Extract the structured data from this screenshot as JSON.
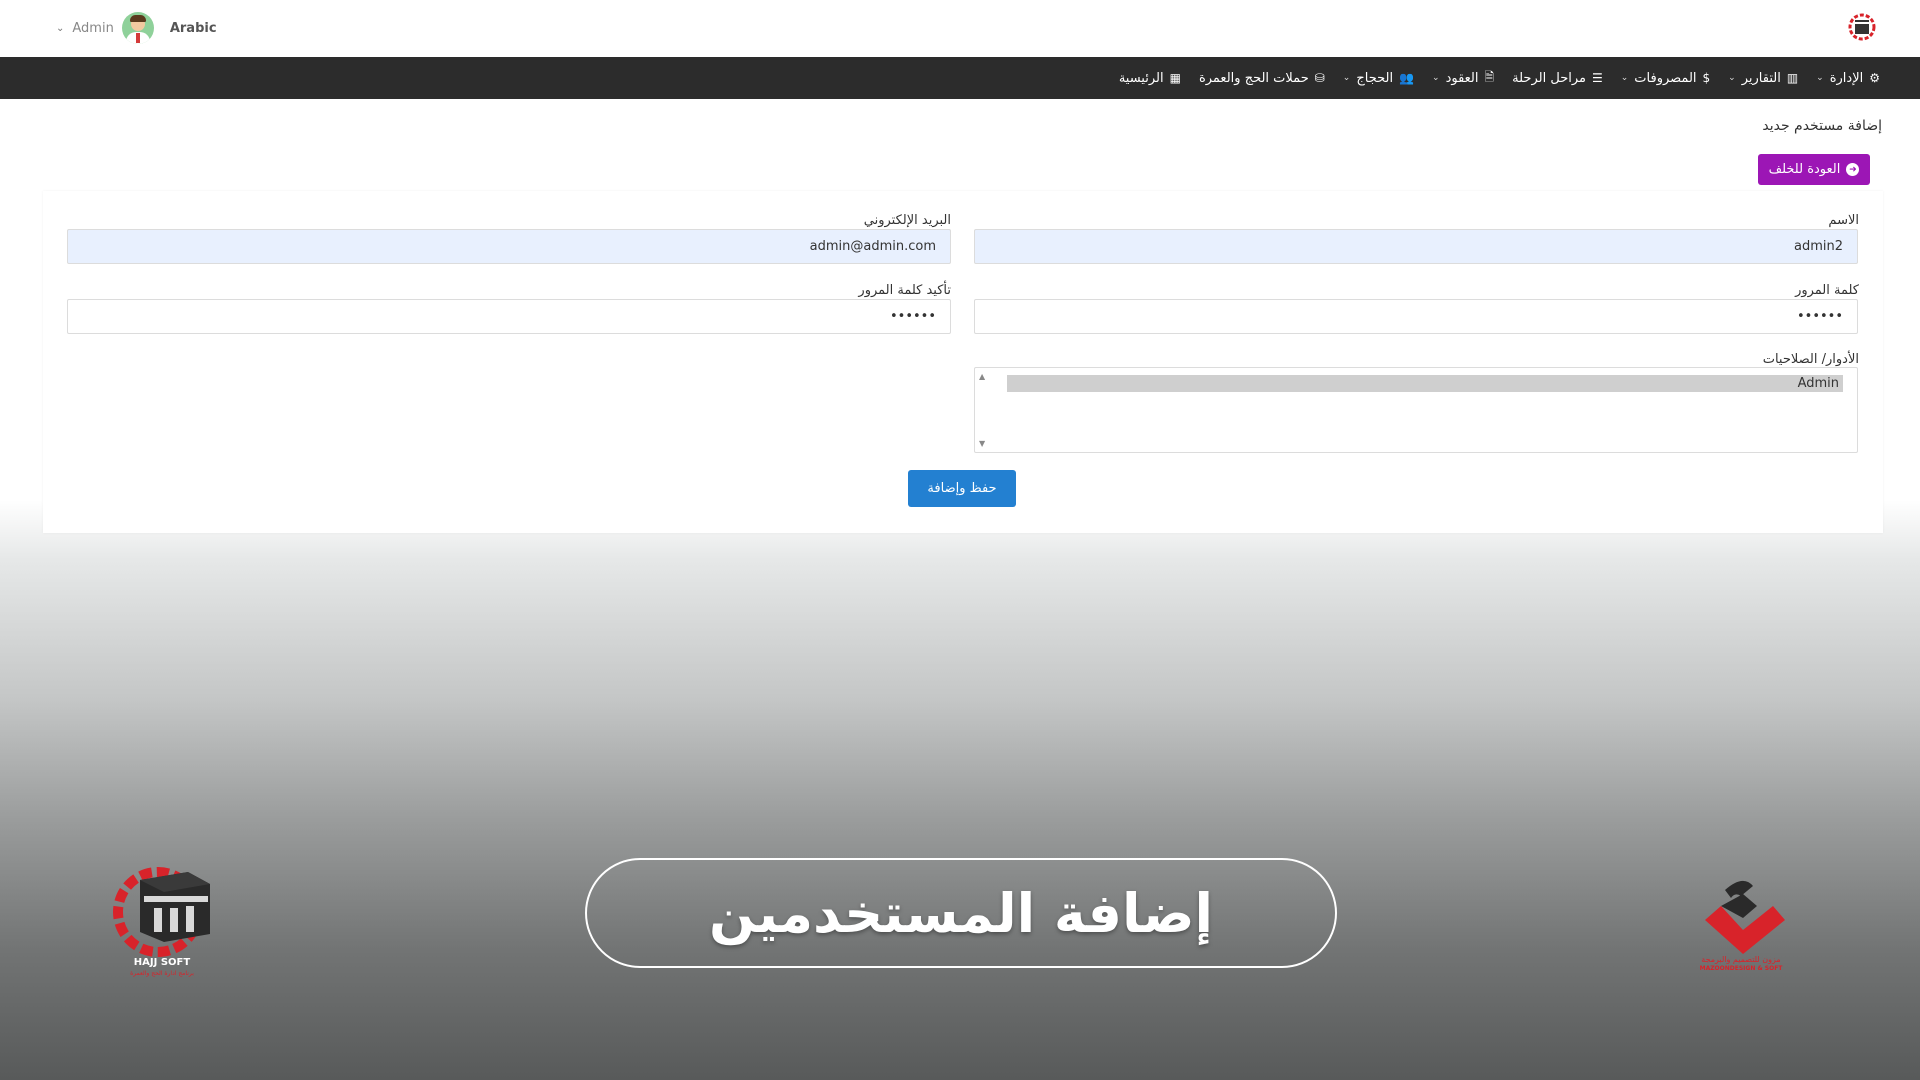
{
  "topbar": {
    "user_name": "Admin",
    "language": "Arabic"
  },
  "nav": {
    "items": [
      {
        "label": "الرئيسية",
        "icon": "dashboard-icon",
        "glyph": "▦",
        "dropdown": false
      },
      {
        "label": "حملات الحج والعمرة",
        "icon": "kaaba-icon",
        "glyph": "⛁",
        "dropdown": false
      },
      {
        "label": "الحجاج",
        "icon": "users-icon",
        "glyph": "👥",
        "dropdown": true
      },
      {
        "label": "العقود",
        "icon": "file-icon",
        "glyph": "🗎",
        "dropdown": true
      },
      {
        "label": "مراحل الرحلة",
        "icon": "list-icon",
        "glyph": "☰",
        "dropdown": false
      },
      {
        "label": "المصروفات",
        "icon": "dollar-icon",
        "glyph": "$",
        "dropdown": true
      },
      {
        "label": "التقارير",
        "icon": "chart-icon",
        "glyph": "▥",
        "dropdown": true
      },
      {
        "label": "الإدارة",
        "icon": "gear-icon",
        "glyph": "⚙",
        "dropdown": true
      }
    ]
  },
  "page": {
    "title": "إضافة مستخدم جديد",
    "back_label": "العودة للخلف"
  },
  "form": {
    "name_label": "الاسم",
    "name_value": "admin2",
    "email_label": "البريد الإلكتروني",
    "email_value": "admin@admin.com",
    "password_label": "كلمة المرور",
    "password_value": "••••••",
    "confirm_label": "تأكيد كلمة المرور",
    "confirm_value": "••••••",
    "roles_label": "الأدوار/ الصلاحيات",
    "roles_selected": "Admin",
    "save_label": "حفظ وإضافة"
  },
  "banner": {
    "text": "إضافة المستخدمين"
  },
  "logos": {
    "left_caption": "HAJJ SOFT",
    "left_sub": "برنامج ادارة الحج والعمرة",
    "right_caption_ar": "مزون للتصميم والبرمجة",
    "right_caption_en": "MAZOONDESIGN & SOFT"
  },
  "colors": {
    "navbar": "#2c2c2c",
    "back_button": "#9c16b5",
    "save_button": "#2380d1",
    "filled_input": "#e8f0fe",
    "brand_red": "#d8232a"
  }
}
